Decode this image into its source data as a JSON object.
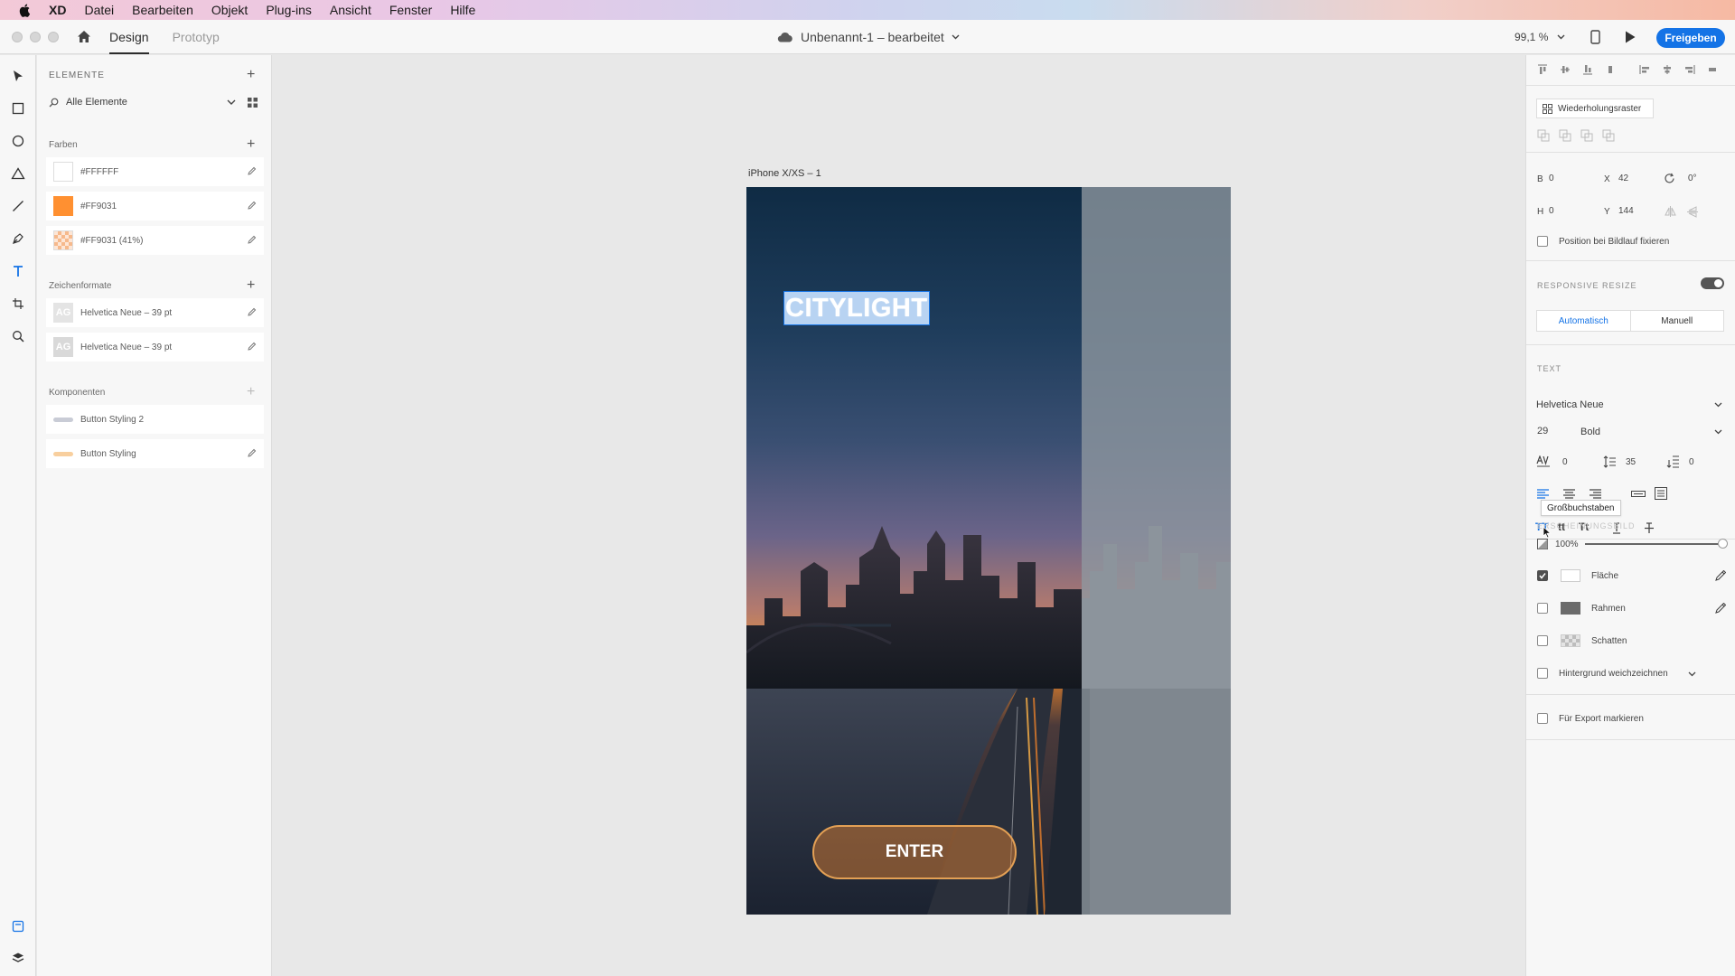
{
  "menubar": {
    "app": "XD",
    "items": [
      "Datei",
      "Bearbeiten",
      "Objekt",
      "Plug-ins",
      "Ansicht",
      "Fenster",
      "Hilfe"
    ]
  },
  "toolbar": {
    "tabs": [
      "Design",
      "Prototyp"
    ],
    "doc_title": "Unbenannt-1 – bearbeitet",
    "zoom": "99,1 %",
    "share_label": "Freigeben",
    "accent": "#1473e6"
  },
  "assets": {
    "title": "ELEMENTE",
    "search": "Alle Elemente",
    "colors_title": "Farben",
    "colors": [
      {
        "label": "#FFFFFF",
        "hex": "#FFFFFF"
      },
      {
        "label": "#FF9031",
        "hex": "#FF9031"
      },
      {
        "label": "#FF9031 (41%)",
        "hex": "#FF9031"
      }
    ],
    "char_title": "Zeichenformate",
    "char_styles": [
      {
        "tile": "AG",
        "label": "Helvetica Neue – 39 pt"
      },
      {
        "tile": "AG",
        "label": "Helvetica Neue – 39 pt"
      }
    ],
    "comp_title": "Komponenten",
    "components": [
      {
        "label": "Button Styling 2",
        "color": "#c9ccd6"
      },
      {
        "label": "Button Styling",
        "color": "#f8cf9e"
      }
    ]
  },
  "canvas": {
    "artboard_label": "iPhone X/XS – 1",
    "title_text": "CITYLIGHT",
    "button_label": "ENTER"
  },
  "props": {
    "repeat_grid": "Wiederholungsraster",
    "w_label": "B",
    "w_value": "0",
    "x_label": "X",
    "x_value": "42",
    "rotation": "0°",
    "h_label": "H",
    "h_value": "0",
    "y_label": "Y",
    "y_value": "144",
    "fix_position": "Position bei Bildlauf fixieren",
    "responsive_title": "RESPONSIVE RESIZE",
    "resize_auto": "Automatisch",
    "resize_manual": "Manuell",
    "text_title": "TEXT",
    "font": "Helvetica Neue",
    "size": "29",
    "weight": "Bold",
    "tracking": "0",
    "line_height": "35",
    "paragraph": "0",
    "tooltip": "Großbuchstaben",
    "appearance_title": "ERSCHEINUNGSBILD",
    "opacity": "100%",
    "fill_label": "Fläche",
    "border_label": "Rahmen",
    "shadow_label": "Schatten",
    "blur_label": "Hintergrund weichzeichnen",
    "export_label": "Für Export markieren",
    "case_buttons": [
      "TT",
      "tt",
      "Tt"
    ]
  }
}
